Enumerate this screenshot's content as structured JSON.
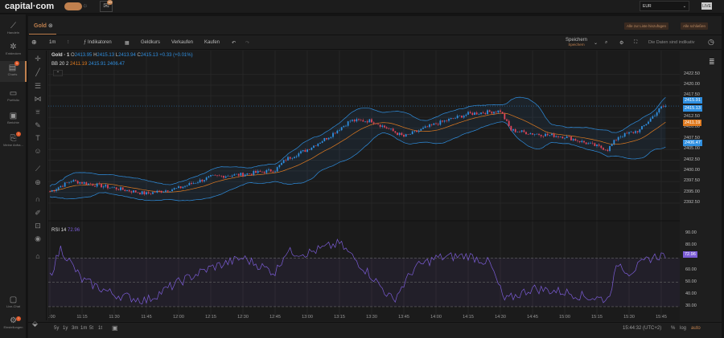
{
  "topbar": {
    "logo": "capital·com",
    "mail_badge": "10",
    "currency": "EUR",
    "mode": "LIVE"
  },
  "sidebar": {
    "items": [
      {
        "label": "Handeln",
        "icon": "trend-icon"
      },
      {
        "label": "Entdecken",
        "icon": "network-icon"
      },
      {
        "label": "Charts",
        "icon": "chart-icon",
        "badge": "1",
        "active": true
      },
      {
        "label": "Portfolio",
        "icon": "briefcase-icon"
      },
      {
        "label": "Berichte",
        "icon": "report-icon"
      },
      {
        "label": "Meine Anfra...",
        "icon": "request-icon",
        "badge": "!"
      }
    ],
    "bottom": [
      {
        "label": "Live-Chat",
        "icon": "chat-icon"
      },
      {
        "label": "Einstellungen",
        "icon": "settings-icon",
        "badge": "!"
      }
    ]
  },
  "tabs": {
    "active": "Gold",
    "add_all": "Alle zur Liste hinzufügen",
    "close_all": "Alle schließen"
  },
  "toolbar": {
    "interval": "1m",
    "indicators": "Indikatoren",
    "bid": "Geldkurs",
    "sell": "Verkaufen",
    "buy": "Kaufen",
    "save": "Speichern",
    "save_sub": "Speichern",
    "indicative": "Die Daten sind indikativ"
  },
  "legend": {
    "symbol": "Gold · 1",
    "o_label": "O",
    "o": "2413.95",
    "h_label": "H",
    "h": "2415.13",
    "l_label": "L",
    "l": "2413.94",
    "c_label": "C",
    "c": "2415.13",
    "change": "+0.33 (+0.01%)",
    "bb_label": "BB 20 2",
    "bb_mid": "2411.19",
    "bb_up": "2415.91",
    "bb_low": "2406.47",
    "rsi_label": "RSI 14",
    "rsi_value": "72.96"
  },
  "colors": {
    "up": "#2f8fe0",
    "down": "#e0455a",
    "bb_mid": "#e07b20",
    "bb_band": "#2f8fe0",
    "rsi": "#7b5cd6",
    "accent": "#c0804e"
  },
  "chart_data": {
    "type": "candlestick",
    "x_ticks": [
      "11:00",
      "11:15",
      "11:30",
      "11:45",
      "12:00",
      "12:15",
      "12:30",
      "12:45",
      "13:00",
      "13:15",
      "13:30",
      "13:45",
      "14:00",
      "14:15",
      "14:30",
      "14:45",
      "15:00",
      "15:15",
      "15:30",
      "15:45"
    ],
    "price_ticks": [
      "2422.50",
      "2420.00",
      "2417.50",
      "2412.50",
      "2410.00",
      "2407.50",
      "2405.00",
      "2402.50",
      "2400.00",
      "2397.50",
      "2395.00",
      "2392.50"
    ],
    "price_range": [
      2391,
      2423
    ],
    "close_path": [
      [
        "11:00",
        2395.2
      ],
      [
        "11:10",
        2397.7
      ],
      [
        "11:30",
        2396.0
      ],
      [
        "11:45",
        2394.7
      ],
      [
        "12:00",
        2396.0
      ],
      [
        "12:15",
        2398.6
      ],
      [
        "12:30",
        2399.2
      ],
      [
        "12:45",
        2400.2
      ],
      [
        "12:50",
        2402.7
      ],
      [
        "13:00",
        2405.0
      ],
      [
        "13:10",
        2408.0
      ],
      [
        "13:20",
        2411.7
      ],
      [
        "13:30",
        2411.7
      ],
      [
        "13:45",
        2408.0
      ],
      [
        "14:00",
        2411.0
      ],
      [
        "14:15",
        2413.3
      ],
      [
        "14:30",
        2414.0
      ],
      [
        "14:35",
        2409.5
      ],
      [
        "14:45",
        2408.7
      ],
      [
        "15:00",
        2408.0
      ],
      [
        "15:10",
        2406.5
      ],
      [
        "15:20",
        2405.0
      ],
      [
        "15:25",
        2408.0
      ],
      [
        "15:35",
        2409.5
      ],
      [
        "15:45",
        2414.8
      ],
      [
        "15:47",
        2415.13
      ]
    ],
    "price_labels": [
      {
        "value": "2415.91",
        "kind": "bb_up"
      },
      {
        "value": "2415.13",
        "kind": "last"
      },
      {
        "value": "2411.19",
        "kind": "bb_mid"
      },
      {
        "value": "2406.47",
        "kind": "bb_low"
      }
    ],
    "rsi_ticks": [
      "90.00",
      "80.00",
      "60.00",
      "50.00",
      "40.00",
      "30.00"
    ],
    "rsi_range": [
      28,
      92
    ],
    "rsi_levels": [
      70,
      50,
      30
    ],
    "rsi_path": [
      [
        "11:00",
        55
      ],
      [
        "11:05",
        78
      ],
      [
        "11:15",
        52
      ],
      [
        "11:30",
        40
      ],
      [
        "11:45",
        35
      ],
      [
        "12:00",
        50
      ],
      [
        "12:15",
        62
      ],
      [
        "12:30",
        70
      ],
      [
        "12:45",
        58
      ],
      [
        "12:50",
        75
      ],
      [
        "13:00",
        74
      ],
      [
        "13:15",
        82
      ],
      [
        "13:30",
        55
      ],
      [
        "13:40",
        35
      ],
      [
        "13:50",
        62
      ],
      [
        "14:00",
        70
      ],
      [
        "14:15",
        72
      ],
      [
        "14:25",
        66
      ],
      [
        "14:32",
        35
      ],
      [
        "14:45",
        45
      ],
      [
        "15:00",
        42
      ],
      [
        "15:10",
        38
      ],
      [
        "15:20",
        36
      ],
      [
        "15:25",
        66
      ],
      [
        "15:30",
        58
      ],
      [
        "15:40",
        70
      ],
      [
        "15:47",
        72.96
      ]
    ]
  },
  "bottom": {
    "ranges": [
      "5y",
      "1y",
      "3m",
      "1m",
      "5t",
      "1t"
    ],
    "time": "15:44:32 (UTC+2)",
    "percent": "%",
    "log": "log",
    "auto": "auto"
  }
}
